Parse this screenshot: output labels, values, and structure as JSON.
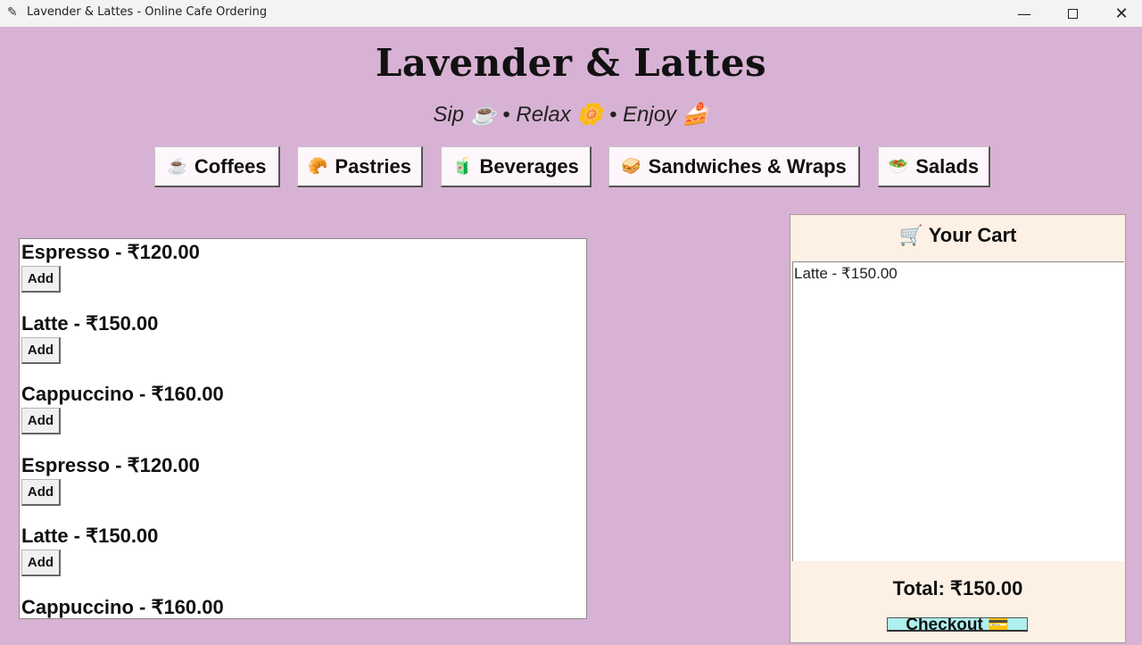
{
  "window": {
    "app_icon": "quill-icon",
    "title": "Lavender & Lattes - Online Cafe Ordering",
    "minimize": "—",
    "close": "✕"
  },
  "header": {
    "brand": "Lavender & Lattes",
    "tagline": "Sip ☕ • Relax 🌼 • Enjoy 🍰"
  },
  "categories": [
    {
      "icon": "☕",
      "label": "Coffees"
    },
    {
      "icon": "🥐",
      "label": "Pastries"
    },
    {
      "icon": "🧃",
      "label": "Beverages"
    },
    {
      "icon": "🥪",
      "label": "Sandwiches & Wraps"
    },
    {
      "icon": "🥗",
      "label": "Salads"
    }
  ],
  "menu": {
    "add_label": "Add",
    "items": [
      {
        "text": "Espresso - ₹120.00"
      },
      {
        "text": "Latte - ₹150.00"
      },
      {
        "text": "Cappuccino - ₹160.00"
      },
      {
        "text": "Espresso - ₹120.00"
      },
      {
        "text": "Latte - ₹150.00"
      },
      {
        "text": "Cappuccino - ₹160.00"
      }
    ]
  },
  "cart": {
    "title": "🛒 Your Cart",
    "lines": [
      "Latte - ₹150.00"
    ],
    "total": "Total: ₹150.00",
    "checkout_label": "Checkout 💳"
  }
}
